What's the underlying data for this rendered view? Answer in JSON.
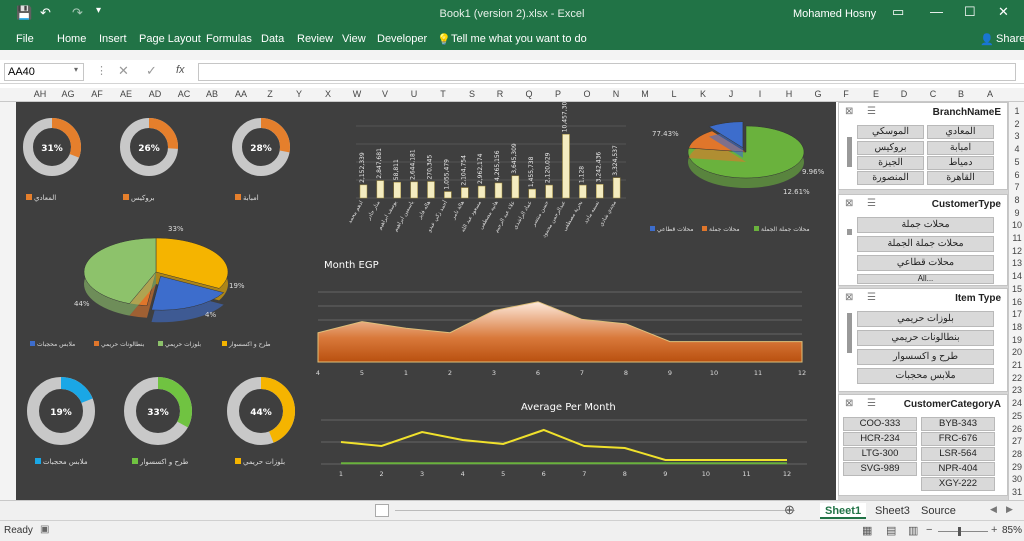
{
  "titlebar": {
    "doc_title": "Book1 (version 2).xlsx  -  Excel",
    "user": "Mohamed Hosny"
  },
  "ribbon": {
    "tabs": [
      "File",
      "Home",
      "Insert",
      "Page Layout",
      "Formulas",
      "Data",
      "Review",
      "View",
      "Developer"
    ],
    "tell_me": "Tell me what you want to do",
    "share": "Share"
  },
  "formula_bar": {
    "name_box": "AA40",
    "formula": ""
  },
  "columns": [
    "AH",
    "AG",
    "AF",
    "AE",
    "AD",
    "AC",
    "AB",
    "AA",
    "Z",
    "Y",
    "X",
    "W",
    "V",
    "U",
    "T",
    "S",
    "R",
    "Q",
    "P",
    "O",
    "N",
    "M",
    "L",
    "K",
    "J",
    "I",
    "H",
    "G",
    "F",
    "E",
    "D",
    "C",
    "B",
    "A"
  ],
  "rows": [
    "1",
    "2",
    "3",
    "4",
    "5",
    "6",
    "7",
    "8",
    "9",
    "10",
    "11",
    "12",
    "13",
    "14",
    "15",
    "16",
    "17",
    "18",
    "19",
    "20",
    "21",
    "22",
    "23",
    "24",
    "25",
    "26",
    "27",
    "28",
    "29",
    "30",
    "31"
  ],
  "small_donuts_top": [
    {
      "pct": "31%",
      "label": "المعادي",
      "value": 31
    },
    {
      "pct": "26%",
      "label": "بروكيس",
      "value": 26
    },
    {
      "pct": "28%",
      "label": "امبابة",
      "value": 28
    }
  ],
  "small_donuts_bottom": [
    {
      "pct": "19%",
      "label": "ملابس محجبات",
      "value": 19,
      "color": "#1aa7e6"
    },
    {
      "pct": "33%",
      "label": "طرح و اكسسوار",
      "value": 33,
      "color": "#70c341"
    },
    {
      "pct": "44%",
      "label": "بلوزات حريمي",
      "value": 44,
      "color": "#f5b400"
    }
  ],
  "bar_chart": {
    "chart_data": {
      "type": "bar",
      "categories": [
        "ادهم محمد",
        "منار حادر",
        "يوسف ابراهيم",
        "ياسمين ابراهيم",
        "هاله فايز",
        "أحمد زكي عبدو",
        "هالة تامر",
        "مسعود عبد الله",
        "هانيه مصطفى",
        "علاء عبد الرحيم",
        "عماد الراشدي",
        "حسن منتصر",
        "عبدالرحمن محمود",
        "بحرية مصطفى",
        "نسمه ماجد",
        "مجدي شادي",
        "باسم اسد",
        "عاصم الحبش",
        "هشام وحيد",
        "نبيل مصطفى"
      ],
      "values": [
        2152339,
        2847681,
        2588811,
        2644181,
        2701345,
        1055479,
        1704754,
        1962174,
        2466156,
        3645309,
        1455738,
        2120029,
        10457307,
        2120029,
        2242436,
        3324537,
        12800000,
        3128000,
        4000000,
        3200000
      ],
      "value_labels": [
        "2,152,339",
        "2,847,681",
        "58,811",
        "2,644,181",
        "270,345",
        "1,055,479",
        "2,104,754",
        "2,962,174",
        "4,265,156",
        "3,645,309",
        "1,455,738",
        "2,120,029",
        "10,457,307",
        "1,128",
        "3,242,436",
        "3,324,537"
      ]
    }
  },
  "top_pie": {
    "chart_data": {
      "type": "pie",
      "labels": [
        "محلات جملة الجملة",
        "محلات جملة",
        "محلات قطاعي"
      ],
      "values": [
        77.43,
        12.61,
        9.96
      ],
      "pct_labels": [
        "77.43%",
        "12.61%",
        "9.96%"
      ],
      "colors": [
        "#6ab23d",
        "#e0762b",
        "#3d6dcc"
      ]
    },
    "legend": [
      "محلات قطاعي",
      "محلات جملة",
      "محلات جملة الجملة"
    ]
  },
  "left_pie": {
    "chart_data": {
      "type": "pie",
      "labels": [
        "بلوزات حريمي",
        "ملابس محجبات",
        "بنطالونات حريمي",
        "طرح و اكسسوار"
      ],
      "values": [
        33,
        19,
        4,
        44
      ],
      "pct_labels": [
        "33%",
        "19%",
        "4%",
        "44%"
      ],
      "colors": [
        "#f5b400",
        "#3d6dcc",
        "#e0762b",
        "#8dc26b"
      ]
    },
    "legend": [
      "ملابس محجبات",
      "بنطالونات حريمي",
      "بلوزات حريمي",
      "طرح و اكسسوار"
    ]
  },
  "area_chart": {
    "title": "Month EGP",
    "chart_data": {
      "type": "area",
      "x": [
        4,
        5,
        1,
        2,
        3,
        6,
        7,
        8,
        9,
        10,
        11,
        12
      ],
      "values": [
        0.3,
        0.55,
        0.4,
        0.3,
        0.8,
        1.0,
        0.6,
        0.5,
        0.1,
        0.1,
        0.1,
        0.1
      ],
      "ylim": [
        0,
        1.4
      ]
    }
  },
  "line_chart": {
    "title": "Average Per Month",
    "chart_data": {
      "type": "line",
      "x": [
        1,
        2,
        3,
        4,
        5,
        6,
        7,
        8,
        9,
        10,
        11,
        12
      ],
      "series": [
        {
          "values": [
            0.55,
            0.45,
            0.8,
            0.6,
            0.5,
            0.85,
            0.45,
            0.4,
            0.1,
            0.1,
            0.1,
            0.1
          ],
          "color": "#f0e12c"
        },
        {
          "values": [
            0.02,
            0.02,
            0.02,
            0.02,
            0.02,
            0.02,
            0.02,
            0.02,
            0.02,
            0.02,
            0.02,
            0.02
          ],
          "color": "#6ab23d"
        }
      ],
      "ylim": [
        0,
        1.1
      ]
    }
  },
  "slicers": {
    "branch": {
      "title": "BranchNameE",
      "items": [
        "المعادي",
        "الموسكي",
        "امبابة",
        "بروكيس",
        "دمياط",
        "الجيزة",
        "القاهرة",
        "المنصورة"
      ]
    },
    "customer_type": {
      "title": "CustomerType",
      "items": [
        "محلات جملة",
        "محلات جملة الجملة",
        "محلات قطاعي",
        "All..."
      ]
    },
    "item_type": {
      "title": "Item Type",
      "items": [
        "بلوزات حريمي",
        "بنطالونات حريمي",
        "طرح و اكسسوار",
        "ملابس محجبات"
      ]
    },
    "customer_category": {
      "title": "CustomerCategoryA",
      "items": [
        "COO-333",
        "BYB-343",
        "HCR-234",
        "FRC-676",
        "LTG-300",
        "LSR-564",
        "SVG-989",
        "NPR-404",
        "XGY-222"
      ]
    }
  },
  "sheet_tabs": [
    "Sheet1",
    "Sheet3",
    "Source"
  ],
  "status": {
    "ready": "Ready",
    "zoom": "85%"
  }
}
